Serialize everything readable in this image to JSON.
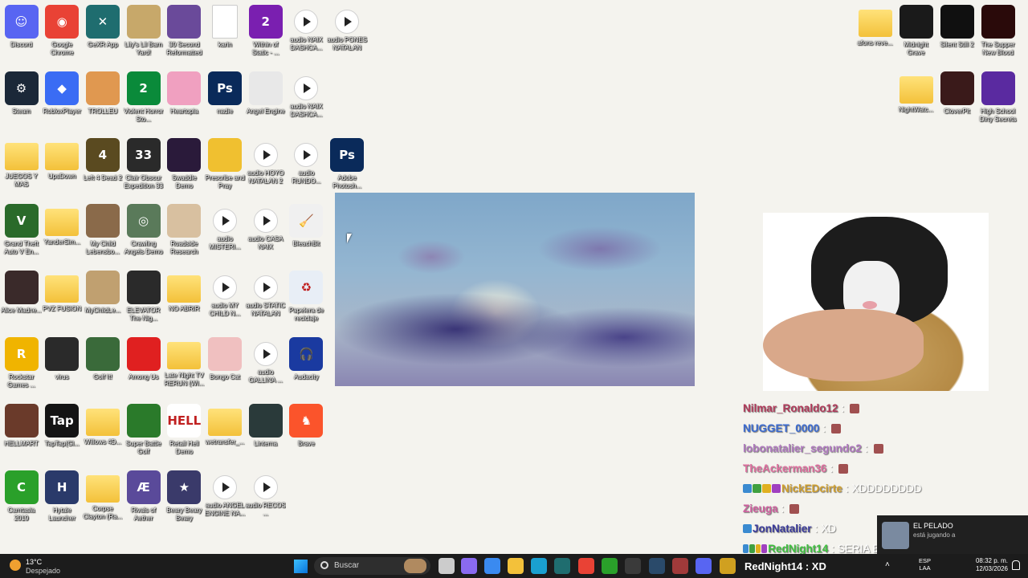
{
  "desktop": {
    "left_icons": [
      {
        "label": "Discord",
        "icon": "discord-icon",
        "color": "#5865f2",
        "glyph": "☺"
      },
      {
        "label": "Google Chrome",
        "icon": "chrome-icon",
        "color": "#e94235",
        "glyph": "◉"
      },
      {
        "label": "GeXR App",
        "icon": "gexr-app-icon",
        "color": "#1f6d6f",
        "glyph": "✕"
      },
      {
        "label": "Lily's Lil Barn Yard!",
        "icon": "game-icon",
        "color": "#c7a86a",
        "glyph": ""
      },
      {
        "label": "30 Second Reformatted",
        "icon": "game-icon",
        "color": "#6a4a9a",
        "glyph": ""
      },
      {
        "label": "karin",
        "icon": "document-icon",
        "color": "#ffffff",
        "glyph": ""
      },
      {
        "label": "Within of Static - ...",
        "icon": "game-icon",
        "color": "#7a1fb0",
        "glyph": "2"
      },
      {
        "label": "audio NAIX DASHCA...",
        "icon": "audio-file-icon",
        "color": "#ffffff",
        "glyph": ""
      },
      {
        "label": "audio PONES NATALAN",
        "icon": "audio-file-icon",
        "color": "#ffffff",
        "glyph": ""
      },
      {
        "label": "Steam",
        "icon": "steam-icon",
        "color": "#1b2838",
        "glyph": "⚙"
      },
      {
        "label": "RobloxPlayer",
        "icon": "roblox-icon",
        "color": "#3a6cf4",
        "glyph": "◆"
      },
      {
        "label": "TROLLEU",
        "icon": "game-icon",
        "color": "#e09850",
        "glyph": ""
      },
      {
        "label": "Violent Horror Sto...",
        "icon": "game-icon",
        "color": "#0a8a3a",
        "glyph": "2"
      },
      {
        "label": "Heartopia",
        "icon": "game-icon",
        "color": "#f0a0c0",
        "glyph": ""
      },
      {
        "label": "nadie",
        "icon": "photoshop-file-icon",
        "color": "#0a2a5a",
        "glyph": "Ps"
      },
      {
        "label": "Angel Engine",
        "icon": "game-icon",
        "color": "#e8e8e8",
        "glyph": ""
      },
      {
        "label": "audio NAIX DASHCA...",
        "icon": "audio-file-icon",
        "color": "#ffffff",
        "glyph": ""
      },
      {
        "label": "JUEGOS Y MAS",
        "icon": "folder-icon",
        "color": "#f3c13a",
        "glyph": ""
      },
      {
        "label": "UpsDown",
        "icon": "folder-icon",
        "color": "#f3c13a",
        "glyph": ""
      },
      {
        "label": "Left 4 Dead 2",
        "icon": "game-icon",
        "color": "#5a4a20",
        "glyph": "4"
      },
      {
        "label": "Clair Obscur Expedition 33",
        "icon": "game-icon",
        "color": "#2a2a2a",
        "glyph": "33"
      },
      {
        "label": "Swaddle Demo",
        "icon": "game-icon",
        "color": "#2a1a3a",
        "glyph": ""
      },
      {
        "label": "Prescribe and Pray",
        "icon": "game-icon",
        "color": "#f0c030",
        "glyph": ""
      },
      {
        "label": "audio HOYO NATALAN 2",
        "icon": "audio-file-icon",
        "color": "#ffffff",
        "glyph": ""
      },
      {
        "label": "audio RUNDO...",
        "icon": "audio-file-icon",
        "color": "#ffffff",
        "glyph": ""
      },
      {
        "label": "Adobe Photosh...",
        "icon": "photoshop-icon",
        "color": "#0a2a5a",
        "glyph": "Ps"
      },
      {
        "label": "Grand Theft Auto V En...",
        "icon": "game-icon",
        "color": "#2a6a2a",
        "glyph": "V"
      },
      {
        "label": "YanderSim...",
        "icon": "folder-icon",
        "color": "#f3c13a",
        "glyph": ""
      },
      {
        "label": "My Child Lebensbo...",
        "icon": "game-icon",
        "color": "#8a6a4a",
        "glyph": ""
      },
      {
        "label": "Crawling Angels Demo",
        "icon": "game-icon",
        "color": "#5a7a5a",
        "glyph": "◎"
      },
      {
        "label": "Roadside Research",
        "icon": "game-icon",
        "color": "#d8c0a0",
        "glyph": ""
      },
      {
        "label": "audio MISTERI...",
        "icon": "audio-file-icon",
        "color": "#ffffff",
        "glyph": ""
      },
      {
        "label": "audio CASA NAIX",
        "icon": "audio-file-icon",
        "color": "#ffffff",
        "glyph": ""
      },
      {
        "label": "BleachBit",
        "icon": "bleachbit-icon",
        "color": "#f0f0f0",
        "glyph": "🧹"
      },
      {
        "label": "Alice Madne...",
        "icon": "game-icon",
        "color": "#3a2a2a",
        "glyph": ""
      },
      {
        "label": "PVZ FUSION",
        "icon": "folder-icon",
        "color": "#f3c13a",
        "glyph": ""
      },
      {
        "label": "MyChildLe...",
        "icon": "game-icon",
        "color": "#c0a070",
        "glyph": ""
      },
      {
        "label": "ELEVATOR The Nig...",
        "icon": "game-icon",
        "color": "#2a2a2a",
        "glyph": ""
      },
      {
        "label": "NO ABRIR",
        "icon": "folder-icon",
        "color": "#f3c13a",
        "glyph": ""
      },
      {
        "label": "audio MY CHILD N...",
        "icon": "audio-file-icon",
        "color": "#ffffff",
        "glyph": ""
      },
      {
        "label": "audio STATIC NATALAN",
        "icon": "audio-file-icon",
        "color": "#ffffff",
        "glyph": ""
      },
      {
        "label": "Papelera de reciclaje",
        "icon": "recycle-bin-icon",
        "color": "#e8eef6",
        "glyph": "♻"
      },
      {
        "label": "Rockstar Games ...",
        "icon": "rockstar-icon",
        "color": "#f0b400",
        "glyph": "R"
      },
      {
        "label": "virus",
        "icon": "virus-icon",
        "color": "#2a2a2a",
        "glyph": ""
      },
      {
        "label": "Golf It!",
        "icon": "game-icon",
        "color": "#3a6a3a",
        "glyph": ""
      },
      {
        "label": "Among Us",
        "icon": "game-icon",
        "color": "#e02020",
        "glyph": ""
      },
      {
        "label": "Late Night TV RERUN (WI...",
        "icon": "folder-icon",
        "color": "#f3c13a",
        "glyph": ""
      },
      {
        "label": "Bongo Cat",
        "icon": "game-icon",
        "color": "#f0c0c0",
        "glyph": ""
      },
      {
        "label": "audio GALLINA ...",
        "icon": "audio-file-icon",
        "color": "#ffffff",
        "glyph": ""
      },
      {
        "label": "Audacity",
        "icon": "audacity-icon",
        "color": "#1a3aa0",
        "glyph": "🎧"
      },
      {
        "label": "HELLMART",
        "icon": "game-icon",
        "color": "#6a3a2a",
        "glyph": ""
      },
      {
        "label": "TapTap(Gl...",
        "icon": "taptap-icon",
        "color": "#141414",
        "glyph": "Tap"
      },
      {
        "label": "Willows 4D...",
        "icon": "folder-icon",
        "color": "#f3c13a",
        "glyph": ""
      },
      {
        "label": "Super Battle Golf",
        "icon": "game-icon",
        "color": "#2a7a2a",
        "glyph": ""
      },
      {
        "label": "Retail Hell Demo",
        "icon": "game-icon",
        "color": "#ffffff",
        "glyph": "HELL"
      },
      {
        "label": "wetransfer_...",
        "icon": "folder-icon",
        "color": "#f3c13a",
        "glyph": ""
      },
      {
        "label": "Linterna",
        "icon": "flashlight-icon",
        "color": "#2a3a3a",
        "glyph": ""
      },
      {
        "label": "Brave",
        "icon": "brave-icon",
        "color": "#fb542b",
        "glyph": "♞"
      },
      {
        "label": "Camtasia 2019",
        "icon": "camtasia-icon",
        "color": "#2aa02a",
        "glyph": "C"
      },
      {
        "label": "Hytale Launcher",
        "icon": "hytale-icon",
        "color": "#2a3a6a",
        "glyph": "H"
      },
      {
        "label": "Corpse Clayton (Ra...",
        "icon": "folder-icon",
        "color": "#f3c13a",
        "glyph": ""
      },
      {
        "label": "Rivals of Aether",
        "icon": "game-icon",
        "color": "#5a4a9a",
        "glyph": "Æ"
      },
      {
        "label": "Beary Beary Beary",
        "icon": "game-icon",
        "color": "#3a3a6a",
        "glyph": "★"
      },
      {
        "label": "audio ANGEL ENGINE NA...",
        "icon": "audio-file-icon",
        "color": "#ffffff",
        "glyph": ""
      },
      {
        "label": "audio RECOS ...",
        "icon": "audio-file-icon",
        "color": "#ffffff",
        "glyph": ""
      }
    ],
    "right_icons": [
      {
        "label": "afons reve...",
        "icon": "zip-folder-icon",
        "color": "#f3c13a",
        "glyph": ""
      },
      {
        "label": "Midnight Grave",
        "icon": "game-icon",
        "color": "#1a1a1a",
        "glyph": ""
      },
      {
        "label": "Silent Still 2",
        "icon": "game-icon",
        "color": "#101010",
        "glyph": ""
      },
      {
        "label": "The Supper New Blood",
        "icon": "game-icon",
        "color": "#2a0a0a",
        "glyph": ""
      },
      {
        "label": "NightWatc...",
        "icon": "folder-icon",
        "color": "#f3c13a",
        "glyph": ""
      },
      {
        "label": "CloverPit",
        "icon": "game-icon",
        "color": "#3a1a1a",
        "glyph": ""
      },
      {
        "label": "High School Dirty Secrets",
        "icon": "game-icon",
        "color": "#5a2aa0",
        "glyph": ""
      }
    ]
  },
  "chat": [
    {
      "user": "Nilmar_Ronaldo12",
      "user_color": "#b03a5a",
      "message": "",
      "badges": 0
    },
    {
      "user": "NUGGET_0000",
      "user_color": "#3a6ad0",
      "message": "",
      "badges": 0
    },
    {
      "user": "lobonatalier_segundo2",
      "user_color": "#b07ac0",
      "message": "",
      "badges": 0
    },
    {
      "user": "TheAckerman36",
      "user_color": "#e070a0",
      "message": "",
      "badges": 0
    },
    {
      "user": "NickEDcirte",
      "user_color": "#d0a030",
      "message": "XDDDDDDDD",
      "badges": 4
    },
    {
      "user": "Zieuga",
      "user_color": "#d060a0",
      "message": "",
      "badges": 0
    },
    {
      "user": "JonNatalier",
      "user_color": "#3a3a9a",
      "message": "XD",
      "badges": 1
    },
    {
      "user": "RedNight14",
      "user_color": "#40c040",
      "message": "SERIA EL FUTURO XD",
      "badges": 4
    }
  ],
  "notification": {
    "name": "EL PELADO",
    "status": "está jugando a"
  },
  "taskbar": {
    "weather_temp": "13°C",
    "weather_cond": "Despejado",
    "search_placeholder": "Buscar",
    "now_playing": "RedNight14 : XD",
    "lang_line1": "ESP",
    "lang_line2": "LAA",
    "time": "08:32 p. m.",
    "date": "12/03/2026",
    "apps": [
      {
        "name": "task-view-icon",
        "color": "#cccccc"
      },
      {
        "name": "copilot-icon",
        "color": "#8a6af0"
      },
      {
        "name": "store-icon",
        "color": "#3a8af0"
      },
      {
        "name": "file-explorer-icon",
        "color": "#f3c13a"
      },
      {
        "name": "edge-icon",
        "color": "#1aa0d0"
      },
      {
        "name": "gexr-taskbar-icon",
        "color": "#1f6d6f"
      },
      {
        "name": "chrome-taskbar-icon",
        "color": "#e94235"
      },
      {
        "name": "camtasia-taskbar-icon",
        "color": "#2aa02a"
      },
      {
        "name": "obs-icon",
        "color": "#3a3a3a"
      },
      {
        "name": "steam-taskbar-icon",
        "color": "#2a4a6a"
      },
      {
        "name": "game-taskbar-icon",
        "color": "#a03a3a"
      },
      {
        "name": "discord-taskbar-icon",
        "color": "#5865f2"
      },
      {
        "name": "app-taskbar-icon",
        "color": "#d0a020"
      }
    ]
  }
}
